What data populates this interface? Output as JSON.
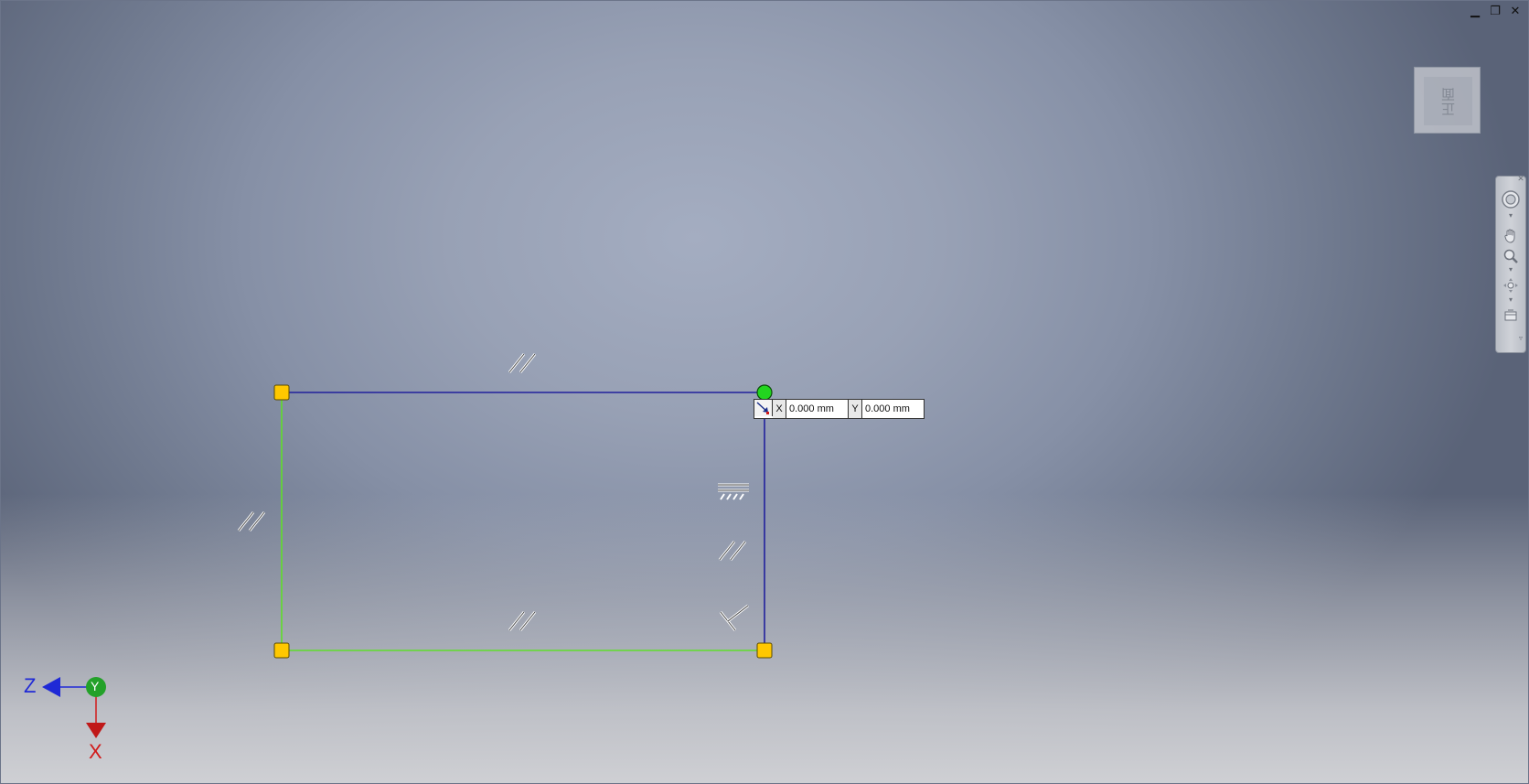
{
  "window": {
    "controls": {
      "minimize": "▁",
      "restore": "❐",
      "close": "✕"
    }
  },
  "viewcube": {
    "face_label": "正面"
  },
  "navbar": {
    "items": [
      "full-navigation-wheel-icon",
      "pan-hand-icon",
      "zoom-icon",
      "orbit-icon",
      "view-face-icon"
    ]
  },
  "coordinate_input": {
    "x_label": "X",
    "x_value": "0.000 mm",
    "y_label": "Y",
    "y_value": "0.000 mm"
  },
  "axis_triad": {
    "z_label": "Z",
    "y_label": "Y",
    "x_label": "X"
  },
  "colors": {
    "sketch_line": "#21209c",
    "constrained_line": "#5fdd2b",
    "endpoint": "#ffc800",
    "active_point": "#22d51f",
    "axis_x": "#d11a1a",
    "axis_y": "#23a129",
    "axis_z": "#1f29d6"
  },
  "constraint_glyphs": [
    "parallel-icon",
    "parallel-icon",
    "parallel-icon",
    "parallel-icon",
    "horizontal-icon",
    "perpendicular-icon"
  ]
}
